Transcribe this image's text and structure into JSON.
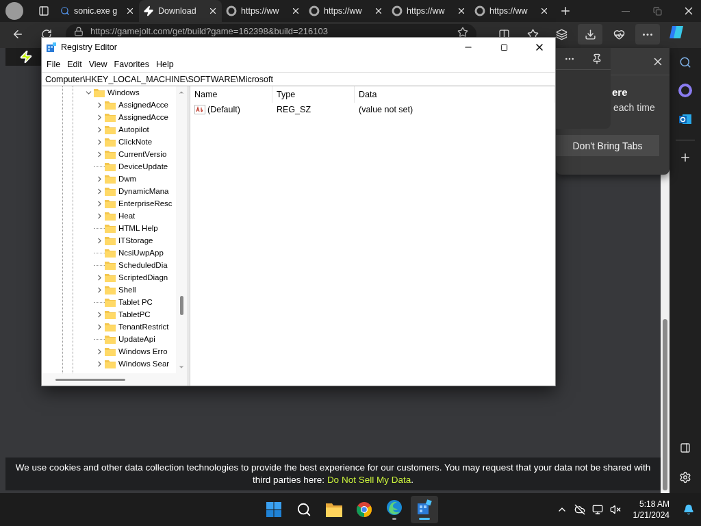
{
  "browser": {
    "tabs": [
      {
        "kind": "search",
        "label": "sonic.exe g",
        "selected": false
      },
      {
        "kind": "bolt",
        "label": "Download",
        "selected": true
      },
      {
        "kind": "globe",
        "label": "https://ww",
        "selected": false
      },
      {
        "kind": "globe",
        "label": "https://ww",
        "selected": false
      },
      {
        "kind": "globe",
        "label": "https://ww",
        "selected": false
      },
      {
        "kind": "globe",
        "label": "https://ww",
        "selected": false
      }
    ],
    "url": "https://gamejolt.com/get/build?game=162398&build=216103"
  },
  "popup": {
    "heading": "ere",
    "text": "each time",
    "button": "Don't Bring Tabs"
  },
  "cookie_banner": {
    "text": "We use cookies and other data collection technologies to provide the best experience for our customers. You may request that your data not be shared with third parties here: ",
    "link": "Do Not Sell My Data",
    "end": "."
  },
  "registry_editor": {
    "title": "Registry Editor",
    "menu": [
      "File",
      "Edit",
      "View",
      "Favorites",
      "Help"
    ],
    "path": "Computer\\HKEY_LOCAL_MACHINE\\SOFTWARE\\Microsoft",
    "tree": {
      "label": "Windows",
      "expanded": true,
      "children": [
        {
          "label": "AssignedAcce",
          "expandable": true
        },
        {
          "label": "AssignedAcce",
          "expandable": true
        },
        {
          "label": "Autopilot",
          "expandable": true
        },
        {
          "label": "ClickNote",
          "expandable": true
        },
        {
          "label": "CurrentVersio",
          "expandable": true
        },
        {
          "label": "DeviceUpdate",
          "expandable": false
        },
        {
          "label": "Dwm",
          "expandable": true
        },
        {
          "label": "DynamicMana",
          "expandable": true
        },
        {
          "label": "EnterpriseResc",
          "expandable": true
        },
        {
          "label": "Heat",
          "expandable": true
        },
        {
          "label": "HTML Help",
          "expandable": false
        },
        {
          "label": "ITStorage",
          "expandable": true
        },
        {
          "label": "NcsiUwpApp",
          "expandable": false
        },
        {
          "label": "ScheduledDia",
          "expandable": false
        },
        {
          "label": "ScriptedDiagn",
          "expandable": true
        },
        {
          "label": "Shell",
          "expandable": true
        },
        {
          "label": "Tablet PC",
          "expandable": false
        },
        {
          "label": "TabletPC",
          "expandable": true
        },
        {
          "label": "TenantRestrict",
          "expandable": true
        },
        {
          "label": "UpdateApi",
          "expandable": false
        },
        {
          "label": "Windows Erro",
          "expandable": true
        },
        {
          "label": "Windows Sear",
          "expandable": true
        }
      ]
    },
    "columns": [
      "Name",
      "Type",
      "Data"
    ],
    "values": [
      {
        "name": "(Default)",
        "type": "REG_SZ",
        "data": "(value not set)"
      }
    ]
  },
  "taskbar": {
    "apps": [
      {
        "kind": "start",
        "running": false,
        "selected": false
      },
      {
        "kind": "search",
        "running": false,
        "selected": false
      },
      {
        "kind": "explorer",
        "running": false,
        "selected": false
      },
      {
        "kind": "chrome",
        "running": false,
        "selected": false
      },
      {
        "kind": "edge",
        "running": true,
        "selected": false
      },
      {
        "kind": "regedit",
        "running": true,
        "selected": true
      }
    ],
    "time": "5:18 AM",
    "date": "1/21/2024"
  }
}
